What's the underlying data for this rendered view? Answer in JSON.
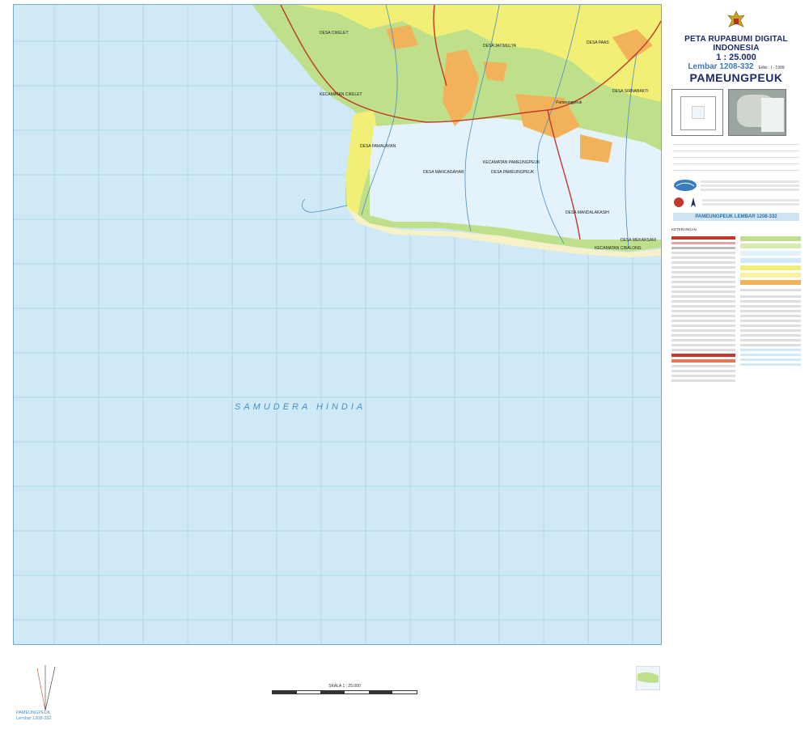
{
  "header": {
    "series_title": "PETA RUPABUMI DIGITAL INDONESIA",
    "scale": "1 : 25.000",
    "sheet": "Lembar 1208-332",
    "edition": "Edisi : I - 1999",
    "sheet_name": "PAMEUNGPEUK"
  },
  "map": {
    "sea_label": "SAMUDERA HINDIA",
    "places": [
      {
        "label": "DESA CIKELET"
      },
      {
        "label": "KECAMATAN CIKELET"
      },
      {
        "label": "DESA JATIMULYA"
      },
      {
        "label": "DESA PAAS"
      },
      {
        "label": "DESA SIRNABAKTI"
      },
      {
        "label": "Pameungpeuk"
      },
      {
        "label": "DESA PAMALAYAN"
      },
      {
        "label": "DESA MANCAGAHAR"
      },
      {
        "label": "KECAMATAN PAMEUNGPEUK"
      },
      {
        "label": "DESA PAMEUNGPEUK"
      },
      {
        "label": "DESA MANDALAKASIH"
      },
      {
        "label": "DESA MEKARSARI"
      },
      {
        "label": "KECAMATAN CIBALONG"
      }
    ],
    "colors": {
      "sea": "#cfe9f6",
      "land_yellow": "#f2ef76",
      "land_green": "#bfe08a",
      "settlement": "#f2b25a",
      "road": "#c0392b",
      "river": "#4a8ec4"
    }
  },
  "legend": {
    "footer_sheet": "PAMEUNGPEUK LEMBAR 1208-332",
    "keterangan": "KETERANGAN",
    "scale_bar_label": "SKALA 1 : 25.000",
    "bottom_left_name": "PAMEUNGPEUK",
    "bottom_left_sheet": "Lembar 1208-332"
  }
}
